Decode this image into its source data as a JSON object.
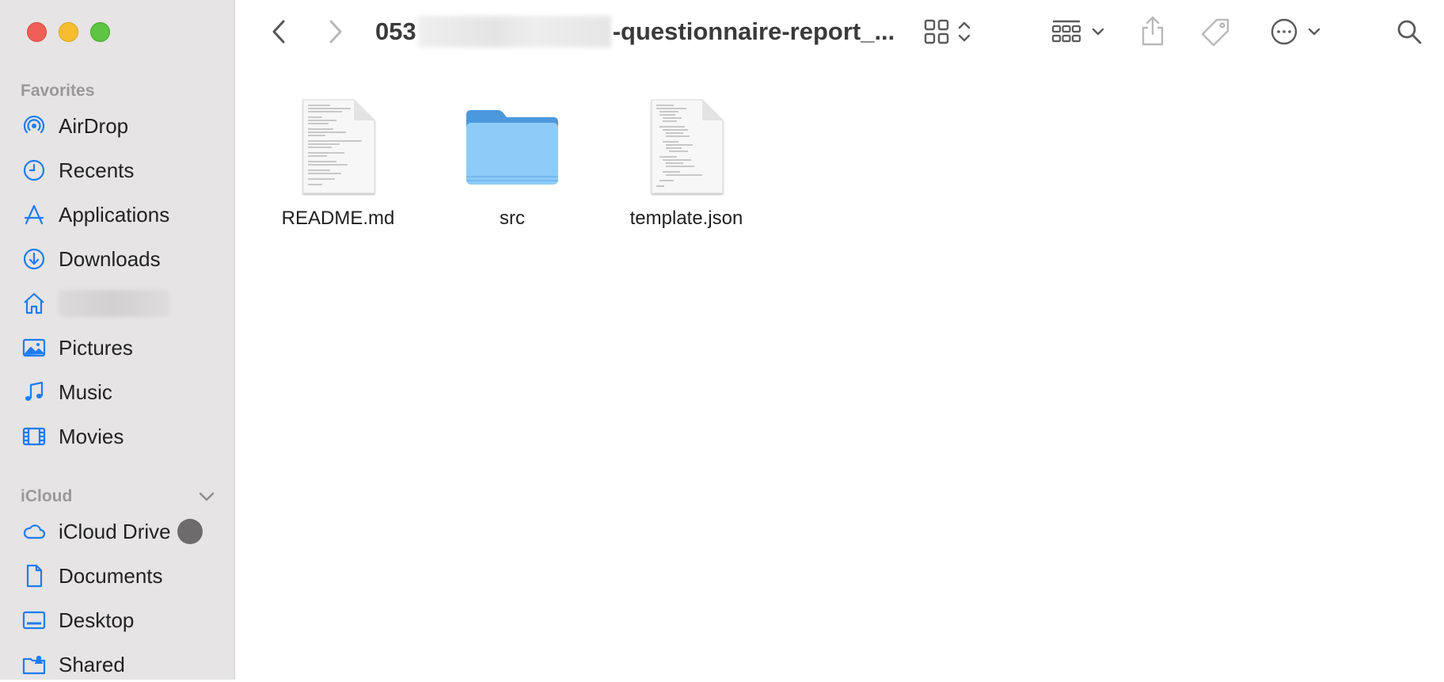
{
  "window": {
    "title_prefix": "053",
    "title_suffix": "-questionnaire-report_..."
  },
  "sidebar": {
    "favorites_title": "Favorites",
    "icloud_title": "iCloud",
    "favorites": [
      {
        "label": "AirDrop",
        "icon": "airdrop-icon"
      },
      {
        "label": "Recents",
        "icon": "clock-icon"
      },
      {
        "label": "Applications",
        "icon": "applications-icon"
      },
      {
        "label": "Downloads",
        "icon": "download-icon"
      },
      {
        "label": "",
        "icon": "home-icon"
      },
      {
        "label": "Pictures",
        "icon": "photo-icon"
      },
      {
        "label": "Music",
        "icon": "music-note-icon"
      },
      {
        "label": "Movies",
        "icon": "film-icon"
      }
    ],
    "icloud": [
      {
        "label": "iCloud Drive",
        "icon": "cloud-icon"
      },
      {
        "label": "Documents",
        "icon": "document-icon"
      },
      {
        "label": "Desktop",
        "icon": "desktop-icon"
      },
      {
        "label": "Shared",
        "icon": "shared-folder-icon"
      }
    ]
  },
  "files": [
    {
      "name": "README.md",
      "kind": "document"
    },
    {
      "name": "src",
      "kind": "folder"
    },
    {
      "name": "template.json",
      "kind": "document"
    }
  ],
  "colors": {
    "accent": "#1d7cf2",
    "sidebar_bg": "#e6e4e4",
    "folder": "#8ecbf6"
  }
}
